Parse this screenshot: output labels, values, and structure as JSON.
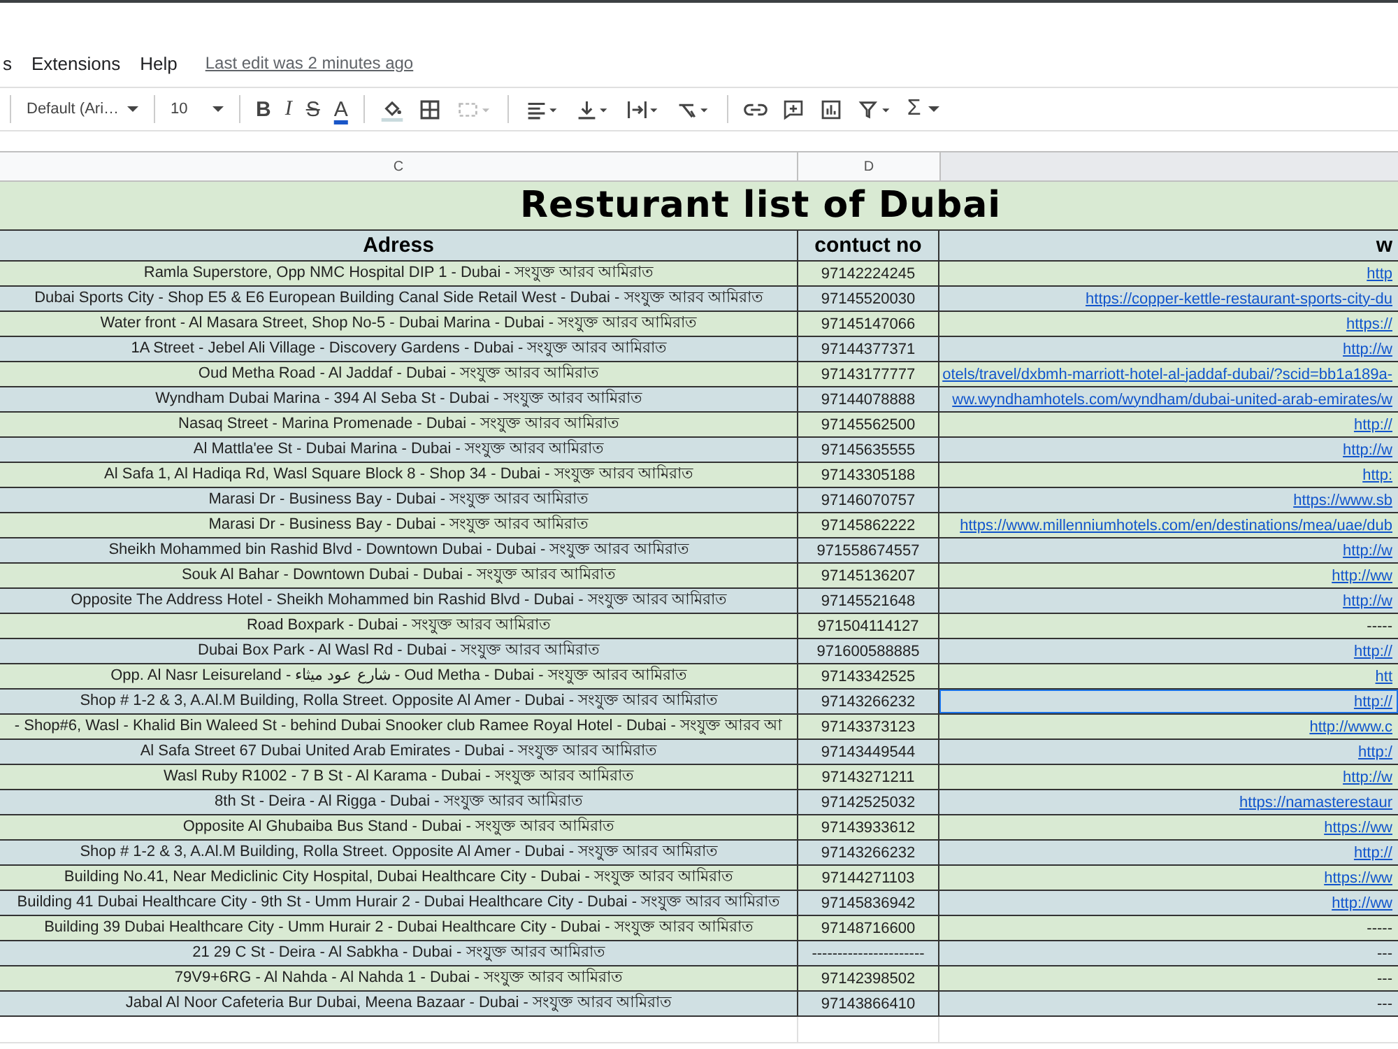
{
  "menu": [
    "s",
    "Extensions",
    "Help"
  ],
  "last_edit": "Last edit was 2 minutes ago",
  "toolbar": {
    "font": "Default (Ari…",
    "size": "10",
    "format": [
      {
        "kind": "bold",
        "label": "B"
      },
      {
        "kind": "italic",
        "label": "I"
      },
      {
        "kind": "strike",
        "label": "S"
      },
      {
        "kind": "color",
        "label": "A"
      }
    ],
    "functions": "Σ"
  },
  "column_headers": [
    "C",
    "D"
  ],
  "title": "Resturant list of Dubai",
  "table": {
    "columns": [
      "Adress",
      "contuct no",
      "w"
    ],
    "rows": [
      {
        "address": "Ramla Superstore, Opp NMC Hospital DIP 1 - Dubai - সংযুক্ত আরব আমিরাত",
        "phone": "97142224245",
        "website": "http",
        "selected": false
      },
      {
        "address": "Dubai Sports City - Shop E5 & E6 European Building Canal Side Retail West - Dubai - সংযুক্ত আরব আমিরাত",
        "phone": "97145520030",
        "website": "https://copper-kettle-restaurant-sports-city-du",
        "selected": false
      },
      {
        "address": "Water front - Al Masara Street, Shop No-5 - Dubai Marina - Dubai - সংযুক্ত আরব আমিরাত",
        "phone": "97145147066",
        "website": "https://",
        "selected": false
      },
      {
        "address": "1A Street - Jebel Ali Village - Discovery Gardens - Dubai - সংযুক্ত আরব আমিরাত",
        "phone": "97144377371",
        "website": "http://w",
        "selected": false
      },
      {
        "address": "Oud Metha Road - Al Jaddaf - Dubai - সংযুক্ত আরব আমিরাত",
        "phone": "97143177777",
        "website": "otels/travel/dxbmh-marriott-hotel-al-jaddaf-dubai/?scid=bb1a189a-",
        "selected": false
      },
      {
        "address": "Wyndham Dubai Marina - 394 Al Seba St - Dubai - সংযুক্ত আরব আমিরাত",
        "phone": "97144078888",
        "website": "ww.wyndhamhotels.com/wyndham/dubai-united-arab-emirates/w",
        "selected": false
      },
      {
        "address": "Nasaq Street - Marina Promenade - Dubai - সংযুক্ত আরব আমিরাত",
        "phone": "97145562500",
        "website": "http://",
        "selected": false
      },
      {
        "address": "Al Mattla'ee St - Dubai Marina - Dubai - সংযুক্ত আরব আমিরাত",
        "phone": "97145635555",
        "website": "http://w",
        "selected": false
      },
      {
        "address": "Al Safa 1, Al Hadiqa Rd, Wasl Square Block 8 - Shop 34 - Dubai - সংযুক্ত আরব আমিরাত",
        "phone": "97143305188",
        "website": "http:",
        "selected": false
      },
      {
        "address": "Marasi Dr - Business Bay - Dubai - সংযুক্ত আরব আমিরাত",
        "phone": "97146070757",
        "website": "https://www.sb",
        "selected": false
      },
      {
        "address": "Marasi Dr - Business Bay - Dubai - সংযুক্ত আরব আমিরাত",
        "phone": "97145862222",
        "website": "https://www.millenniumhotels.com/en/destinations/mea/uae/dub",
        "selected": false
      },
      {
        "address": "Sheikh Mohammed bin Rashid Blvd - Downtown Dubai - Dubai - সংযুক্ত আরব আমিরাত",
        "phone": "971558674557",
        "website": "http://w",
        "selected": false
      },
      {
        "address": "Souk Al Bahar - Downtown Dubai - Dubai - সংযুক্ত আরব আমিরাত",
        "phone": "97145136207",
        "website": "http://ww",
        "selected": false
      },
      {
        "address": "Opposite The Address Hotel - Sheikh Mohammed bin Rashid Blvd - Dubai - সংযুক্ত আরব আমিরাত",
        "phone": "97145521648",
        "website": "http://w",
        "selected": false
      },
      {
        "address": "Road Boxpark - Dubai - সংযুক্ত আরব আমিরাত",
        "phone": "971504114127",
        "website": "-----",
        "selected": false
      },
      {
        "address": "Dubai Box Park - Al Wasl Rd - Dubai - সংযুক্ত আরব আমিরাত",
        "phone": "971600588885",
        "website": "http://",
        "selected": false
      },
      {
        "address": "Opp. Al Nasr Leisureland - شارع عود ميثاء - Oud Metha - Dubai - সংযুক্ত আরব আমিরাত",
        "phone": "97143342525",
        "website": "htt",
        "selected": false
      },
      {
        "address": "Shop # 1-2 & 3, A.Al.M Building, Rolla Street. Opposite Al Amer - Dubai - সংযুক্ত আরব আমিরাত",
        "phone": "97143266232",
        "website": "http://",
        "selected": true
      },
      {
        "address": "- Shop#6, Wasl - Khalid Bin Waleed St - behind Dubai Snooker club Ramee Royal Hotel - Dubai - সংযুক্ত আরব আ",
        "phone": "97143373123",
        "website": "http://www.c",
        "selected": false
      },
      {
        "address": "Al Safa Street 67 Dubai United Arab Emirates - Dubai - সংযুক্ত আরব আমিরাত",
        "phone": "97143449544",
        "website": "http:/",
        "selected": false
      },
      {
        "address": "Wasl Ruby R1002 - 7 B St - Al Karama - Dubai - সংযুক্ত আরব আমিরাত",
        "phone": "97143271211",
        "website": "http://w",
        "selected": false
      },
      {
        "address": "8th St - Deira - Al Rigga - Dubai - সংযুক্ত আরব আমিরাত",
        "phone": "97142525032",
        "website": "https://namasterestaur",
        "selected": false
      },
      {
        "address": "Opposite Al Ghubaiba Bus Stand - Dubai - সংযুক্ত আরব আমিরাত",
        "phone": "97143933612",
        "website": "https://ww",
        "selected": false
      },
      {
        "address": "Shop # 1-2 & 3, A.Al.M Building, Rolla Street. Opposite Al Amer - Dubai - সংযুক্ত আরব আমিরাত",
        "phone": "97143266232",
        "website": "http://",
        "selected": false
      },
      {
        "address": "Building No.41, Near Mediclinic City Hospital, Dubai Healthcare City - Dubai - সংযুক্ত আরব আমিরাত",
        "phone": "97144271103",
        "website": "https://ww",
        "selected": false
      },
      {
        "address": "Building 41 Dubai Healthcare City - 9th St - Umm Hurair 2 - Dubai Healthcare City - Dubai - সংযুক্ত আরব আমিরাত",
        "phone": "97145836942",
        "website": "http://ww",
        "selected": false
      },
      {
        "address": "Building 39 Dubai Healthcare City - Umm Hurair 2 - Dubai Healthcare City - Dubai - সংযুক্ত আরব আমিরাত",
        "phone": "97148716600",
        "website": "-----",
        "selected": false
      },
      {
        "address": "21 29 C St - Deira - Al Sabkha - Dubai - সংযুক্ত আরব আমিরাত",
        "phone": "----------------------",
        "website": "---",
        "selected": false
      },
      {
        "address": "79V9+6RG - Al Nahda - Al Nahda 1 - Dubai - সংযুক্ত আরব আমিরাত",
        "phone": "97142398502",
        "website": "---",
        "selected": false
      },
      {
        "address": "Jabal Al Noor Cafeteria Bur Dubai, Meena Bazaar - Dubai - সংযুক্ত আরব আমিরাত",
        "phone": "97143866410",
        "website": "---",
        "selected": false
      }
    ]
  }
}
